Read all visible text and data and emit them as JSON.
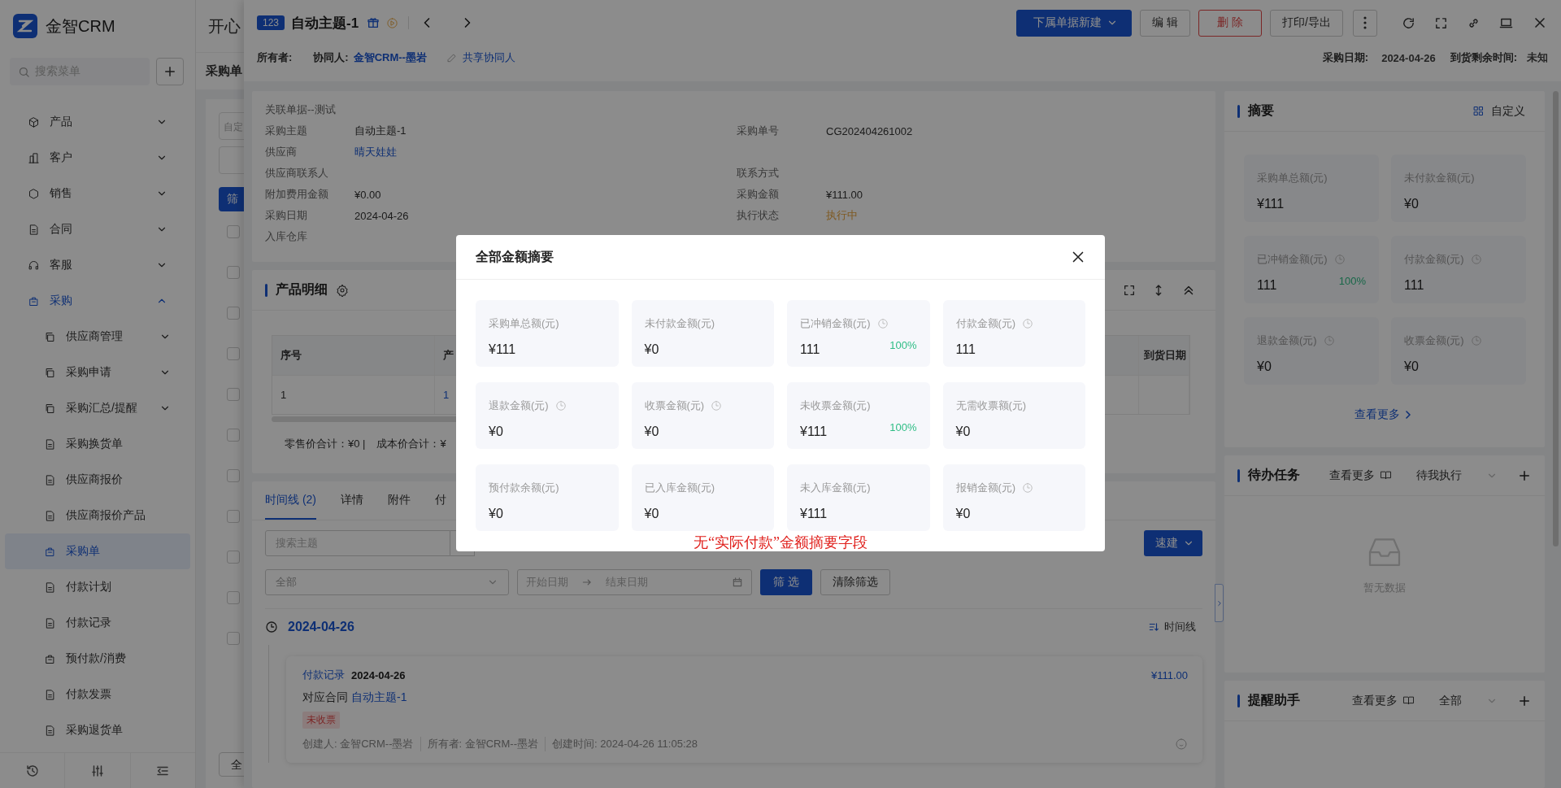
{
  "sidebar": {
    "brand": "金智CRM",
    "search": {
      "placeholder": "搜索菜单"
    },
    "items": [
      {
        "label": "产品",
        "expanded": false,
        "selected": false
      },
      {
        "label": "客户",
        "expanded": false,
        "selected": false
      },
      {
        "label": "销售",
        "expanded": false,
        "selected": false
      },
      {
        "label": "合同",
        "expanded": false,
        "selected": false
      },
      {
        "label": "客服",
        "expanded": false,
        "selected": false
      },
      {
        "label": "采购",
        "expanded": true,
        "selected": false,
        "children": [
          {
            "label": "供应商管理",
            "expanded": false,
            "selected": false
          },
          {
            "label": "采购申请",
            "expanded": false,
            "selected": false
          },
          {
            "label": "采购汇总/提醒",
            "expanded": false,
            "selected": false
          },
          {
            "label": "采购换货单",
            "selected": false
          },
          {
            "label": "供应商报价",
            "selected": false
          },
          {
            "label": "供应商报价产品",
            "selected": false
          },
          {
            "label": "采购单",
            "selected": true
          },
          {
            "label": "付款计划",
            "selected": false
          },
          {
            "label": "付款记录",
            "selected": false
          },
          {
            "label": "预付款/消费",
            "selected": false
          },
          {
            "label": "付款发票",
            "selected": false
          },
          {
            "label": "采购退货单",
            "selected": false
          }
        ]
      }
    ]
  },
  "background_page": {
    "title": "开心",
    "tab": "采购单",
    "filter_text": "自定",
    "filter_button": "筛",
    "footer_select": "全",
    "rows": [
      {
        "checked": false
      },
      {
        "checked": false
      },
      {
        "checked": false
      },
      {
        "checked": false
      },
      {
        "checked": false
      },
      {
        "checked": false
      },
      {
        "checked": false
      },
      {
        "checked": false
      },
      {
        "checked": false
      },
      {
        "checked": false
      },
      {
        "checked": false
      }
    ]
  },
  "drawer": {
    "badge": "123",
    "title": "自动主题-1",
    "buttons": [
      {
        "label": "下属单据新建",
        "kind": "primary"
      },
      {
        "label": "编 辑",
        "kind": "default"
      },
      {
        "label": "删 除",
        "kind": "danger"
      },
      {
        "label": "打印/导出",
        "kind": "default"
      }
    ],
    "owner_row": {
      "owner_label": "所有者:",
      "collaborator_label": "协同人:",
      "collaborator": "金智CRM--墨岩",
      "share_link": "共享协同人",
      "date_label": "采购日期:",
      "date": "2024-04-26",
      "remaining_label": "到货剩余时间:",
      "remaining": "未知"
    },
    "detail": {
      "section": "关联单据--测试",
      "rows": [
        [
          {
            "label": "采购主题",
            "value": "自动主题-1",
            "kind": "text"
          },
          {
            "label": "采购单号",
            "value": "CG202404261002",
            "kind": "text"
          }
        ],
        [
          {
            "label": "供应商",
            "value": "晴天娃娃",
            "kind": "link"
          }
        ],
        [
          {
            "label": "供应商联系人"
          },
          {
            "label": "联系方式"
          }
        ],
        [
          {
            "label": "附加费用金额",
            "value": "¥0.00",
            "kind": "text"
          },
          {
            "label": "采购金额",
            "value": "¥111.00",
            "kind": "text"
          }
        ],
        [
          {
            "label": "采购日期",
            "value": "2024-04-26",
            "kind": "text"
          },
          {
            "label": "执行状态",
            "value": "执行中",
            "kind": "status"
          }
        ],
        [
          {
            "label": "入库仓库"
          }
        ]
      ]
    },
    "products": {
      "title": "产品明细",
      "columns": [
        "序号",
        "产"
      ],
      "last_column": "到货日期",
      "rows": [
        [
          "1",
          "1"
        ]
      ],
      "totals": [
        "零售价合计：¥0 |",
        "成本价合计：¥"
      ]
    },
    "timeline": {
      "tabs": [
        {
          "label": "时间线 (2)",
          "selected": true
        },
        {
          "label": "详情",
          "selected": false
        },
        {
          "label": "附件",
          "selected": false
        },
        {
          "label": "付",
          "selected": false
        }
      ],
      "search": {
        "placeholder": "搜索主题"
      },
      "quick_button": "速建",
      "type_select": "全部",
      "start_placeholder": "开始日期",
      "end_placeholder": "结束日期",
      "filter_button": "筛 选",
      "clear_button": "清除筛选",
      "date": "2024-04-26",
      "view_label": "时间线",
      "entries": [
        {
          "tag": "付款记录",
          "date": "2024-04-26",
          "amount": "¥111.00",
          "contract_label": "对应合同",
          "contract": "自动主题-1",
          "badge": "未收票",
          "meta": [
            "创建人: 金智CRM--墨岩",
            "所有者: 金智CRM--墨岩",
            "创建时间: 2024-04-26 11:05:28"
          ]
        }
      ]
    }
  },
  "summary_panel": {
    "title": "摘要",
    "customize": "自定义",
    "cards": [
      {
        "label": "采购单总额(元)",
        "value": "¥111",
        "clock": false
      },
      {
        "label": "未付款金额(元)",
        "value": "¥0",
        "clock": false
      },
      {
        "label": "已冲销金额(元)",
        "value": "111",
        "clock": true,
        "percent": "100%"
      },
      {
        "label": "付款金额(元)",
        "value": "111",
        "clock": true
      },
      {
        "label": "退款金额(元)",
        "value": "¥0",
        "clock": true
      },
      {
        "label": "收票金额(元)",
        "value": "¥0",
        "clock": true
      }
    ],
    "more": "查看更多"
  },
  "tasks_panel": {
    "title": "待办任务",
    "more": "查看更多",
    "filter": "待我执行",
    "empty": "暂无数据"
  },
  "reminder_panel": {
    "title": "提醒助手",
    "more": "查看更多",
    "filter": "全部"
  },
  "modal": {
    "title": "全部金额摘要",
    "cards": [
      {
        "label": "采购单总额(元)",
        "value": "¥111",
        "clock": false
      },
      {
        "label": "未付款金额(元)",
        "value": "¥0",
        "clock": false
      },
      {
        "label": "已冲销金额(元)",
        "value": "111",
        "clock": true,
        "percent": "100%"
      },
      {
        "label": "付款金额(元)",
        "value": "111",
        "clock": true
      },
      {
        "label": "退款金额(元)",
        "value": "¥0",
        "clock": true
      },
      {
        "label": "收票金额(元)",
        "value": "¥0",
        "clock": true
      },
      {
        "label": "未收票金额(元)",
        "value": "¥111",
        "clock": false,
        "percent": "100%"
      },
      {
        "label": "无需收票额(元)",
        "value": "¥0",
        "clock": false
      },
      {
        "label": "预付款余额(元)",
        "value": "¥0",
        "clock": false
      },
      {
        "label": "已入库金额(元)",
        "value": "¥0",
        "clock": false
      },
      {
        "label": "未入库金额(元)",
        "value": "¥111",
        "clock": false
      },
      {
        "label": "报销金额(元)",
        "value": "¥0",
        "clock": true
      }
    ],
    "note": "无“实际付款”金额摘要字段"
  }
}
